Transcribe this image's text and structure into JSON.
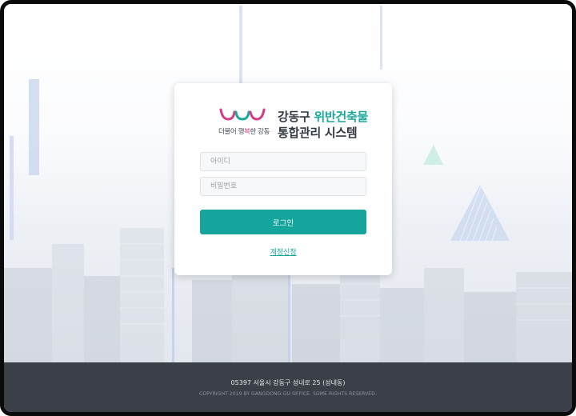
{
  "brand": {
    "slogan_pre": "더불어 행",
    "slogan_mid": "복",
    "slogan_post": "한 강동",
    "title_district": "강동구 ",
    "title_highlight": "위반건축물",
    "title_line2": "통합관리 시스템"
  },
  "login": {
    "id_placeholder": "아이디",
    "password_placeholder": "비밀번호",
    "submit_label": "로그인",
    "signup_label": "계정신청"
  },
  "footer": {
    "address": "05397 서울시 강동구 성내로 25 (성내동)",
    "copyright": "COPYRIGHT 2019 BY GANGDONG-GU OFFICE. SOME RIGHTS RESERVED."
  },
  "colors": {
    "accent": "#16a59c",
    "logo_pink": "#d43d83",
    "logo_teal": "#1ba89b",
    "footer_bg": "#3b3f47"
  }
}
